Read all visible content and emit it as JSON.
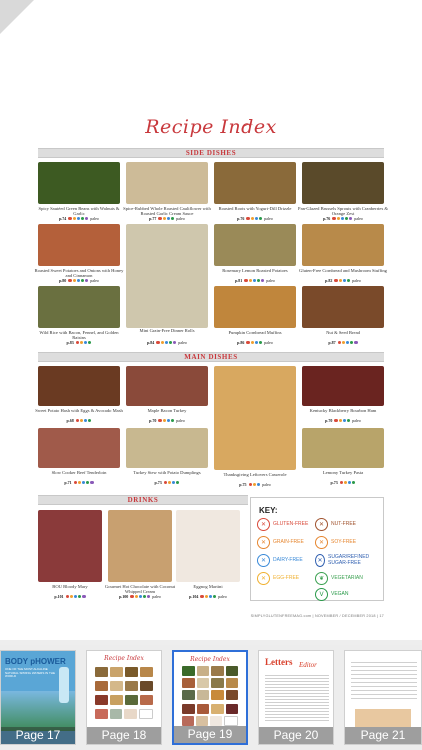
{
  "page": {
    "title": "Recipe Index",
    "footer": "SIMPLYGLUTENFREEMAG.com  |  NOVEMBER / DECEMBER 2018  |  17"
  },
  "side_dishes": {
    "heading": "SIDE DISHES",
    "items": [
      {
        "name": "Spicy Sautéed Green Beans with Walnuts & Garlic",
        "page": "p.74",
        "dots": [
          "#d94a3a",
          "#f0a030",
          "#3a8ad8",
          "#2a9a4a",
          "#8a5ab8"
        ],
        "paleo": "paleo"
      },
      {
        "name": "Spice-Rubbed Whole Roasted Cauliflower with Roasted Garlic Cream Sauce",
        "page": "p.77",
        "dots": [
          "#d94a3a",
          "#f0a030",
          "#3a8ad8",
          "#2a9a4a"
        ],
        "paleo": "paleo"
      },
      {
        "name": "Roasted Roots with Yogurt-Dill Drizzle",
        "page": "p.76",
        "dots": [
          "#d94a3a",
          "#f0a030",
          "#3a8ad8",
          "#2a9a4a"
        ],
        "paleo": "paleo"
      },
      {
        "name": "Pan-Glazed Brussels Sprouts with Cranberries & Orange Zest",
        "page": "p.76",
        "dots": [
          "#d94a3a",
          "#f0a030",
          "#3a8ad8",
          "#2a9a4a",
          "#8a5ab8"
        ],
        "paleo": "paleo"
      },
      {
        "name": "Roasted Sweet Potatoes and Onions with Honey and Cinnamon",
        "page": "p.80",
        "dots": [
          "#d94a3a",
          "#f0a030",
          "#3a8ad8",
          "#2a9a4a",
          "#8a5ab8"
        ],
        "paleo": "paleo"
      },
      {
        "name": "",
        "page": "",
        "dots": [],
        "paleo": ""
      },
      {
        "name": "Rosemary Lemon Roasted Potatoes",
        "page": "p.81",
        "dots": [
          "#d94a3a",
          "#f0a030",
          "#3a8ad8",
          "#2a9a4a",
          "#8a5ab8"
        ],
        "paleo": "paleo"
      },
      {
        "name": "Gluten-Free Cornbread and Mushroom Stuffing",
        "page": "p.82",
        "dots": [
          "#d94a3a",
          "#f0a030",
          "#3a8ad8",
          "#2a9a4a"
        ],
        "paleo": "paleo"
      },
      {
        "name": "Wild Rice with Bacon, Fennel, and Golden Raisins",
        "page": "p.83",
        "dots": [
          "#d94a3a",
          "#f0a030",
          "#3a8ad8",
          "#2a9a4a"
        ],
        "paleo": ""
      },
      {
        "name": "Mini Grain-Free Dinner Rolls",
        "page": "p.84",
        "dots": [
          "#d94a3a",
          "#f0a030",
          "#3a8ad8",
          "#2a9a4a",
          "#8a5ab8"
        ],
        "paleo": "paleo"
      },
      {
        "name": "Pumpkin Cornbread Muffins",
        "page": "p.86",
        "dots": [
          "#d94a3a",
          "#f0a030",
          "#3a8ad8",
          "#2a9a4a"
        ],
        "paleo": "paleo"
      },
      {
        "name": "Nut & Seed Bread",
        "page": "p.87",
        "dots": [
          "#d94a3a",
          "#f0a030",
          "#3a8ad8",
          "#2a9a4a",
          "#8a5ab8"
        ],
        "paleo": ""
      }
    ]
  },
  "main_dishes": {
    "heading": "MAIN DISHES",
    "items": [
      {
        "name": "Sweet Potato Hash with Eggs & Avocado Mash",
        "page": "p.68",
        "dots": [
          "#d94a3a",
          "#f0a030",
          "#3a8ad8",
          "#2a9a4a"
        ],
        "paleo": ""
      },
      {
        "name": "Maple Bacon Turkey",
        "page": "p.70",
        "dots": [
          "#d94a3a",
          "#f0a030",
          "#3a8ad8",
          "#2a9a4a"
        ],
        "paleo": "paleo"
      },
      {
        "name": "Thanksgiving Leftovers Casserole",
        "page": "p.75",
        "dots": [
          "#d94a3a",
          "#f0a030",
          "#3a8ad8"
        ],
        "paleo": "paleo"
      },
      {
        "name": "Kentucky Blackberry Bourbon Ham",
        "page": "p.70",
        "dots": [
          "#d94a3a",
          "#f0a030",
          "#3a8ad8",
          "#2a9a4a"
        ],
        "paleo": "paleo"
      },
      {
        "name": "Slow Cooker Beef Tenderloin",
        "page": "p.71",
        "dots": [
          "#d94a3a",
          "#f0a030",
          "#3a8ad8",
          "#2a9a4a",
          "#8a5ab8"
        ],
        "paleo": ""
      },
      {
        "name": "Turkey Stew with Potato Dumplings",
        "page": "p.73",
        "dots": [
          "#d94a3a",
          "#f0a030",
          "#3a8ad8",
          "#2a9a4a"
        ],
        "paleo": ""
      },
      {
        "name": "Lemony Turkey Pasta",
        "page": "p.73",
        "dots": [
          "#d94a3a",
          "#f0a030",
          "#3a8ad8",
          "#2a9a4a"
        ],
        "paleo": ""
      }
    ]
  },
  "drinks": {
    "heading": "DRINKS",
    "items": [
      {
        "name": "BOU Bloody Mary",
        "page": "p.101",
        "dots": [
          "#d94a3a",
          "#f0a030",
          "#3a8ad8",
          "#2a9a4a",
          "#8a5ab8"
        ],
        "paleo": ""
      },
      {
        "name": "Gourmet Hot Chocolate with Coconut Whipped Cream",
        "page": "p.100",
        "dots": [
          "#d94a3a",
          "#f0a030",
          "#3a8ad8",
          "#2a9a4a",
          "#8a5ab8"
        ],
        "paleo": "paleo"
      },
      {
        "name": "Eggnog Martini",
        "page": "p.104",
        "dots": [
          "#d94a3a",
          "#f0a030",
          "#3a8ad8",
          "#2a9a4a"
        ],
        "paleo": "paleo"
      }
    ]
  },
  "key": {
    "title": "KEY:",
    "items": [
      {
        "label": "GLUTEN-FREE",
        "color": "#d94a3a",
        "icon": "wheat-icon",
        "glyph": "✕"
      },
      {
        "label": "NUT-FREE",
        "color": "#a0522d",
        "icon": "nut-icon",
        "glyph": "✕"
      },
      {
        "label": "GRAIN-FREE",
        "color": "#e6862f",
        "icon": "grain-icon",
        "glyph": "✕"
      },
      {
        "label": "SOY-FREE",
        "color": "#e6862f",
        "icon": "soy-icon",
        "glyph": "✕"
      },
      {
        "label": "DAIRY-FREE",
        "color": "#3a8ad8",
        "icon": "milk-icon",
        "glyph": "✕"
      },
      {
        "label": "SUGAR/REFINED SUGAR-FREE",
        "color": "#2f5fb0",
        "icon": "sugar-icon",
        "glyph": "✕"
      },
      {
        "label": "EGG-FREE",
        "color": "#f0b030",
        "icon": "egg-icon",
        "glyph": "✕"
      },
      {
        "label": "VEGETARIAN",
        "color": "#3aa050",
        "icon": "leaf-icon",
        "glyph": "❦"
      },
      {
        "label": "",
        "color": "#2a9a4a",
        "icon": "",
        "glyph": ""
      },
      {
        "label": "VEGAN",
        "color": "#2a9a4a",
        "icon": "vegan-icon",
        "glyph": "V"
      }
    ]
  },
  "thumbnails": [
    {
      "label": "Page 17",
      "selected": false
    },
    {
      "label": "Page 18",
      "selected": false
    },
    {
      "label": "Page 19",
      "selected": true
    },
    {
      "label": "Page 20",
      "selected": false
    },
    {
      "label": "Page 21",
      "selected": false
    }
  ],
  "thumb_text": {
    "body_power": "BODY pHOWER",
    "body_power_sub": "ONE OF THE MOST ALKALINE NATURAL SPRING WATERS IN THE WORLD",
    "letters_title": "Letters",
    "letters_sub": "Editor"
  }
}
